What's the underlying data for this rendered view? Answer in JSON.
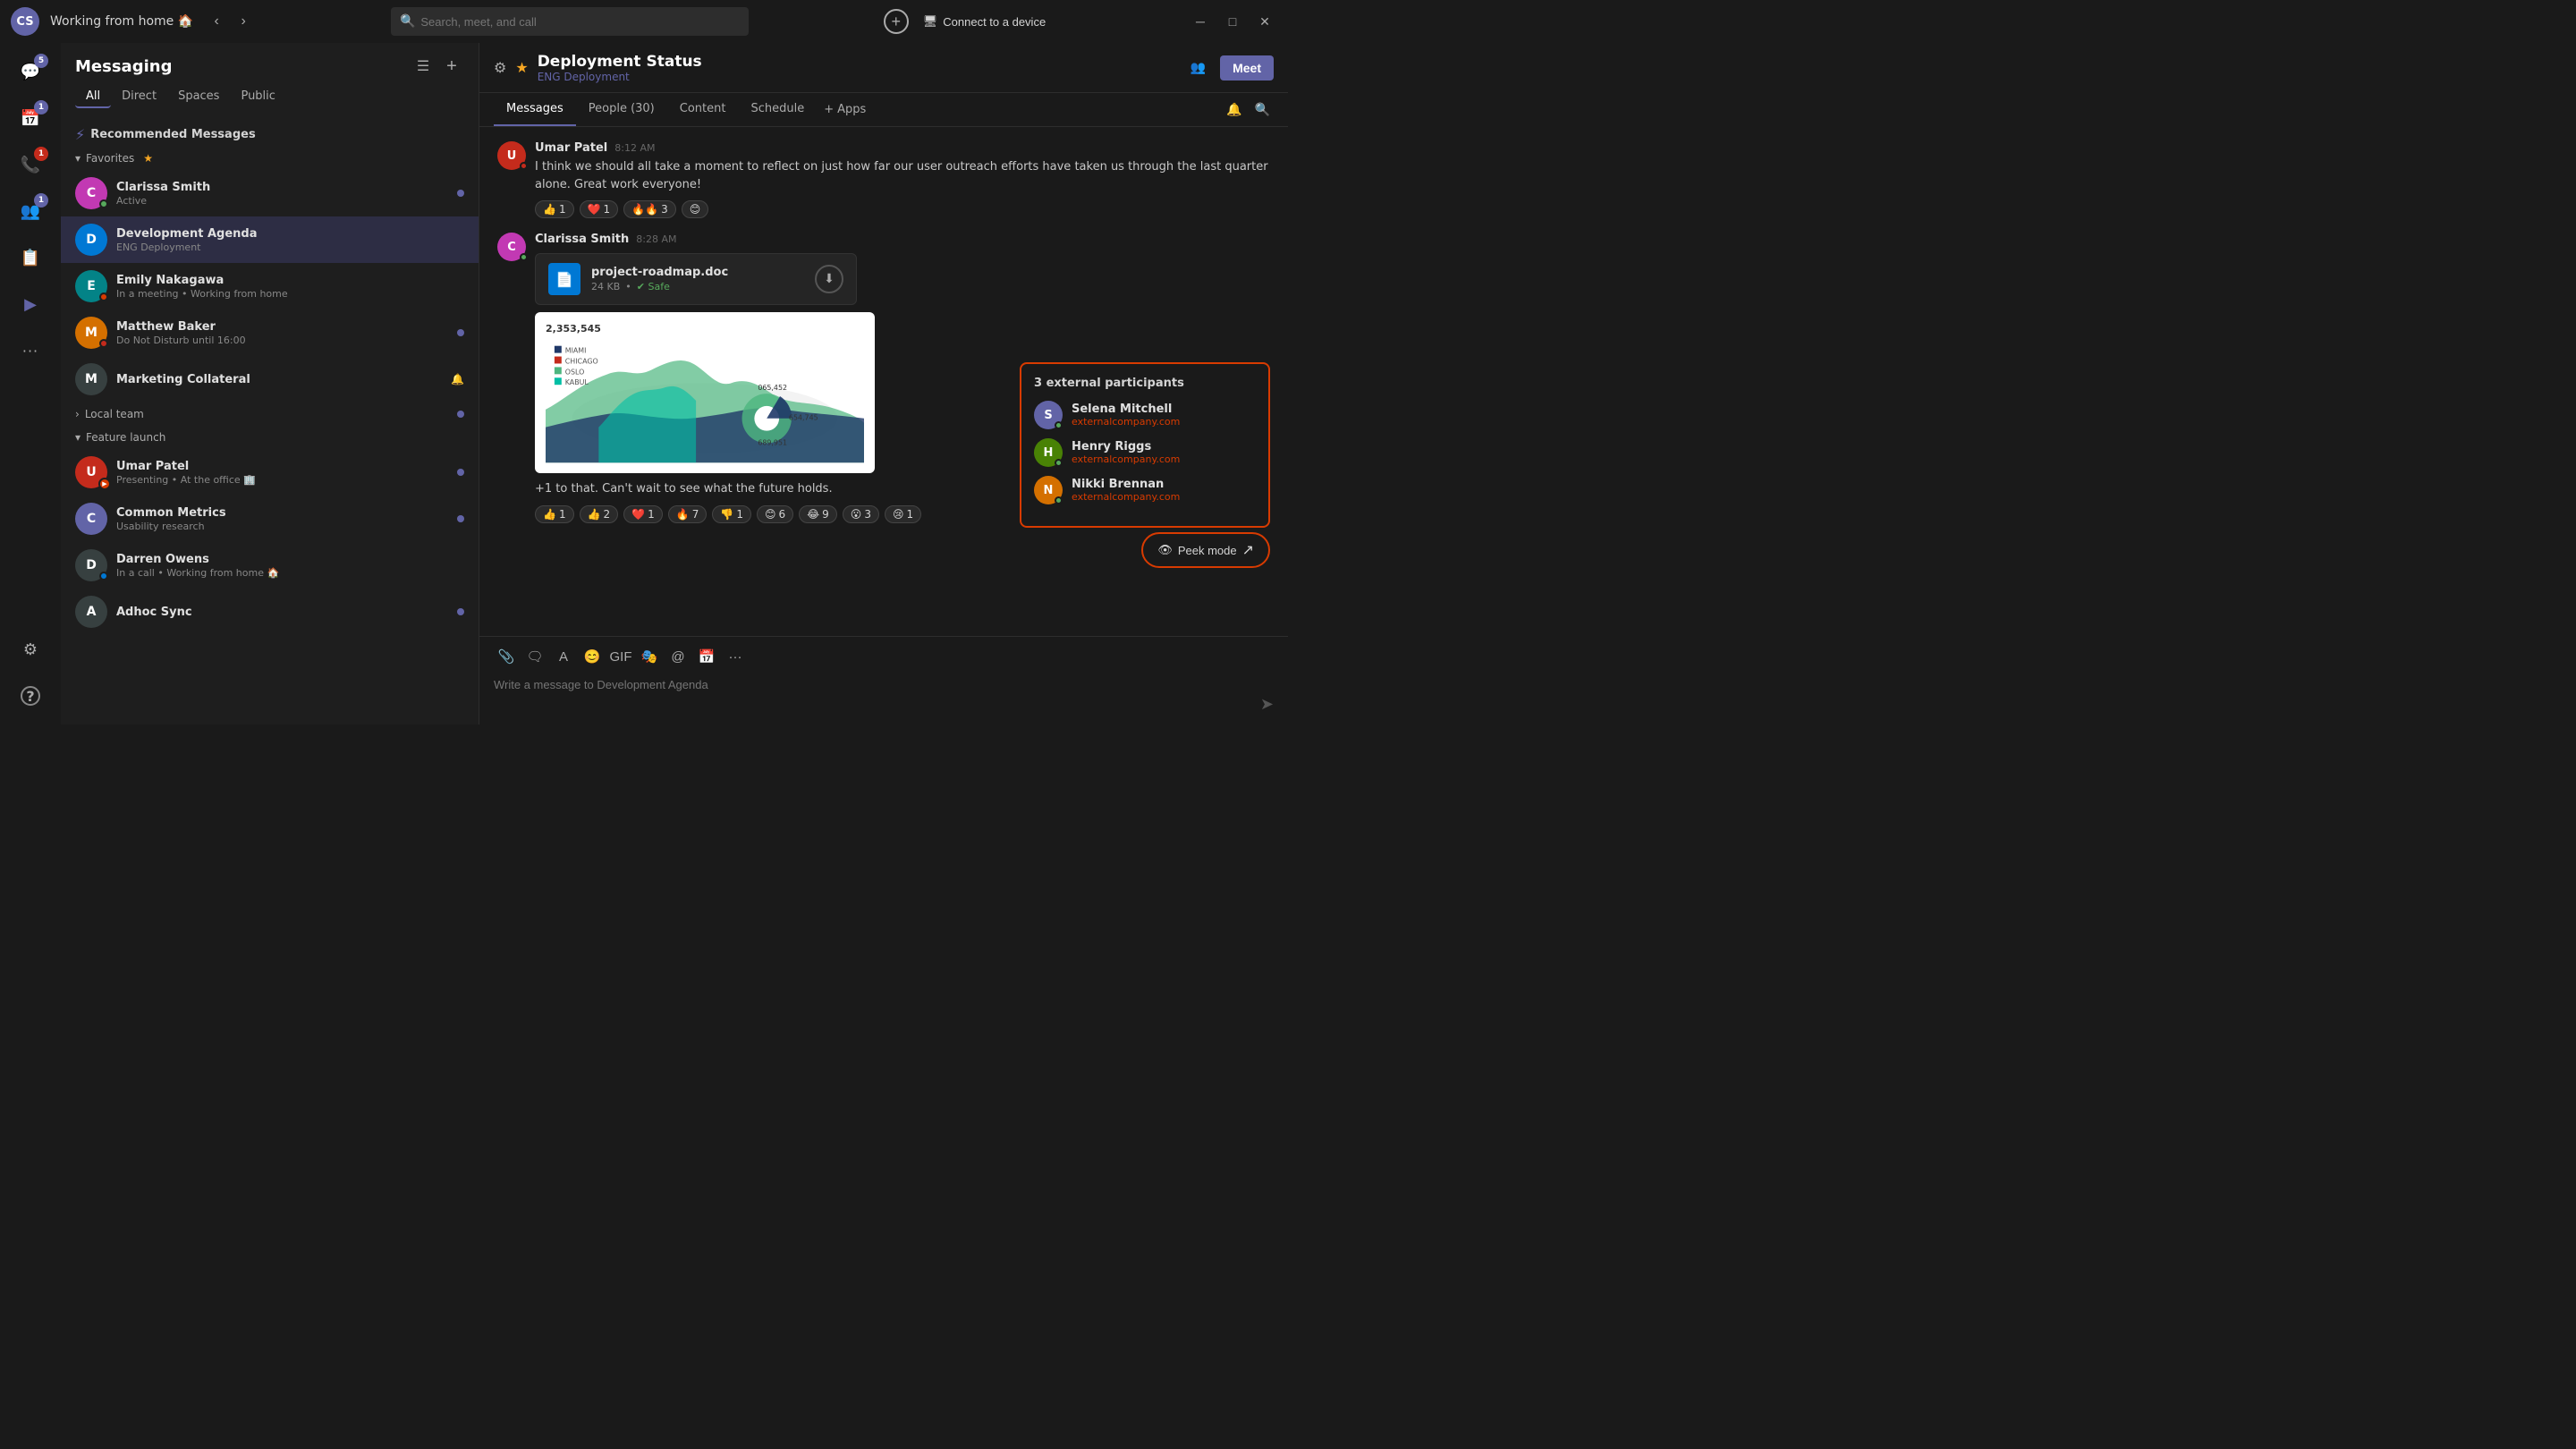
{
  "app": {
    "title": "Working from home 🏠",
    "window_controls": [
      "minimize",
      "maximize",
      "close"
    ]
  },
  "topbar": {
    "user_initials": "CS",
    "title": "Working from home 🏠",
    "search_placeholder": "Search, meet, and call",
    "connect_device_label": "Connect to a device",
    "nav_back": "‹",
    "nav_forward": "›",
    "add_btn": "+"
  },
  "icon_sidebar": {
    "items": [
      {
        "id": "chat",
        "icon": "💬",
        "badge": "5",
        "badge_color": "purple"
      },
      {
        "id": "calendar",
        "icon": "📅",
        "badge": "1",
        "badge_color": "purple"
      },
      {
        "id": "calls",
        "icon": "📞",
        "badge": "1",
        "badge_color": "red"
      },
      {
        "id": "people",
        "icon": "👥",
        "badge": "1",
        "badge_color": "purple"
      },
      {
        "id": "contacts",
        "icon": "📋"
      },
      {
        "id": "activity",
        "icon": "▶"
      },
      {
        "id": "more",
        "icon": "···"
      }
    ],
    "bottom": [
      {
        "id": "settings",
        "icon": "⚙"
      },
      {
        "id": "help",
        "icon": "?"
      }
    ]
  },
  "messaging": {
    "title": "Messaging",
    "tabs": [
      {
        "id": "all",
        "label": "All",
        "active": true
      },
      {
        "id": "direct",
        "label": "Direct"
      },
      {
        "id": "spaces",
        "label": "Spaces"
      },
      {
        "id": "public",
        "label": "Public"
      }
    ],
    "recommended": {
      "label": "Recommended Messages"
    },
    "favorites_label": "Favorites",
    "favorites_items": [
      {
        "id": "clarissa",
        "name": "Clarissa Smith",
        "status": "Active",
        "status_type": "green",
        "unread": true,
        "starred": true
      },
      {
        "id": "development-agenda",
        "name": "Development Agenda",
        "sub": "ENG Deployment",
        "avatar_letter": "D",
        "avatar_color": "blue",
        "active": true
      },
      {
        "id": "emily",
        "name": "Emily Nakagawa",
        "status": "In a meeting • Working from home",
        "status_type": "orange"
      },
      {
        "id": "matthew",
        "name": "Matthew Baker",
        "status": "Do Not Disturb until 16:00",
        "status_type": "red",
        "unread": true
      },
      {
        "id": "marketing",
        "name": "Marketing Collateral",
        "avatar_letter": "M",
        "avatar_color": "dark",
        "muted": true
      }
    ],
    "local_team_label": "Local team",
    "local_team_badge": true,
    "feature_launch_label": "Feature launch",
    "feature_launch_items": [
      {
        "id": "umar",
        "name": "Umar Patel",
        "status": "Presenting • At the office 🏢",
        "status_type": "presenting",
        "unread": true
      },
      {
        "id": "common-metrics",
        "name": "Common Metrics",
        "sub": "Usability research",
        "avatar_letter": "C",
        "avatar_color": "purple",
        "unread": true
      },
      {
        "id": "darren",
        "name": "Darren Owens",
        "status": "In a call • Working from home 🏠",
        "status_type": "blue"
      },
      {
        "id": "adhoc",
        "name": "Adhoc Sync",
        "avatar_letter": "A",
        "avatar_color": "dark",
        "unread": true
      }
    ]
  },
  "channel": {
    "name": "Deployment Status",
    "subname": "ENG Deployment",
    "tabs": [
      {
        "id": "messages",
        "label": "Messages",
        "active": true
      },
      {
        "id": "people",
        "label": "People (30)"
      },
      {
        "id": "content",
        "label": "Content"
      },
      {
        "id": "schedule",
        "label": "Schedule"
      },
      {
        "id": "apps",
        "label": "Apps"
      }
    ],
    "meet_label": "Meet",
    "add_tab_label": "+ Apps"
  },
  "messages": [
    {
      "id": "umar-msg",
      "sender": "Umar Patel",
      "time": "8:12 AM",
      "text": "I think we should all take a moment to reflect on just how far our user outreach efforts have taken us through the last quarter alone. Great work everyone!",
      "reactions": [
        {
          "emoji": "👍",
          "count": "1"
        },
        {
          "emoji": "❤️",
          "count": "1"
        },
        {
          "emoji": "🔥🔥",
          "count": "3"
        },
        {
          "emoji": "😊",
          "count": ""
        }
      ]
    },
    {
      "id": "clarissa-msg",
      "sender": "Clarissa Smith",
      "time": "8:28 AM",
      "file": {
        "name": "project-roadmap.doc",
        "size": "24 KB",
        "safe": "Safe"
      },
      "chart": {
        "label": "2,353,545",
        "has_chart": true
      },
      "text": "+1 to that. Can't wait to see what the future holds.",
      "reactions": [
        {
          "emoji": "👍",
          "count": "1"
        },
        {
          "emoji": "👍",
          "count": "2"
        },
        {
          "emoji": "❤️",
          "count": "1"
        },
        {
          "emoji": "🔥",
          "count": "7"
        },
        {
          "emoji": "👎",
          "count": "1"
        },
        {
          "emoji": "😊",
          "count": "6"
        },
        {
          "emoji": "😂",
          "count": "9"
        },
        {
          "emoji": "😮",
          "count": "3"
        },
        {
          "emoji": "😢",
          "count": "1"
        }
      ]
    }
  ],
  "message_input": {
    "placeholder": "Write a message to Development Agenda"
  },
  "external_popup": {
    "title": "3 external participants",
    "people": [
      {
        "name": "Selena Mitchell",
        "email": "externalcompany.com"
      },
      {
        "name": "Henry Riggs",
        "email": "externalcompany.com"
      },
      {
        "name": "Nikki Brennan",
        "email": "externalcompany.com"
      }
    ]
  },
  "peek_btn": {
    "label": "Peek mode"
  }
}
